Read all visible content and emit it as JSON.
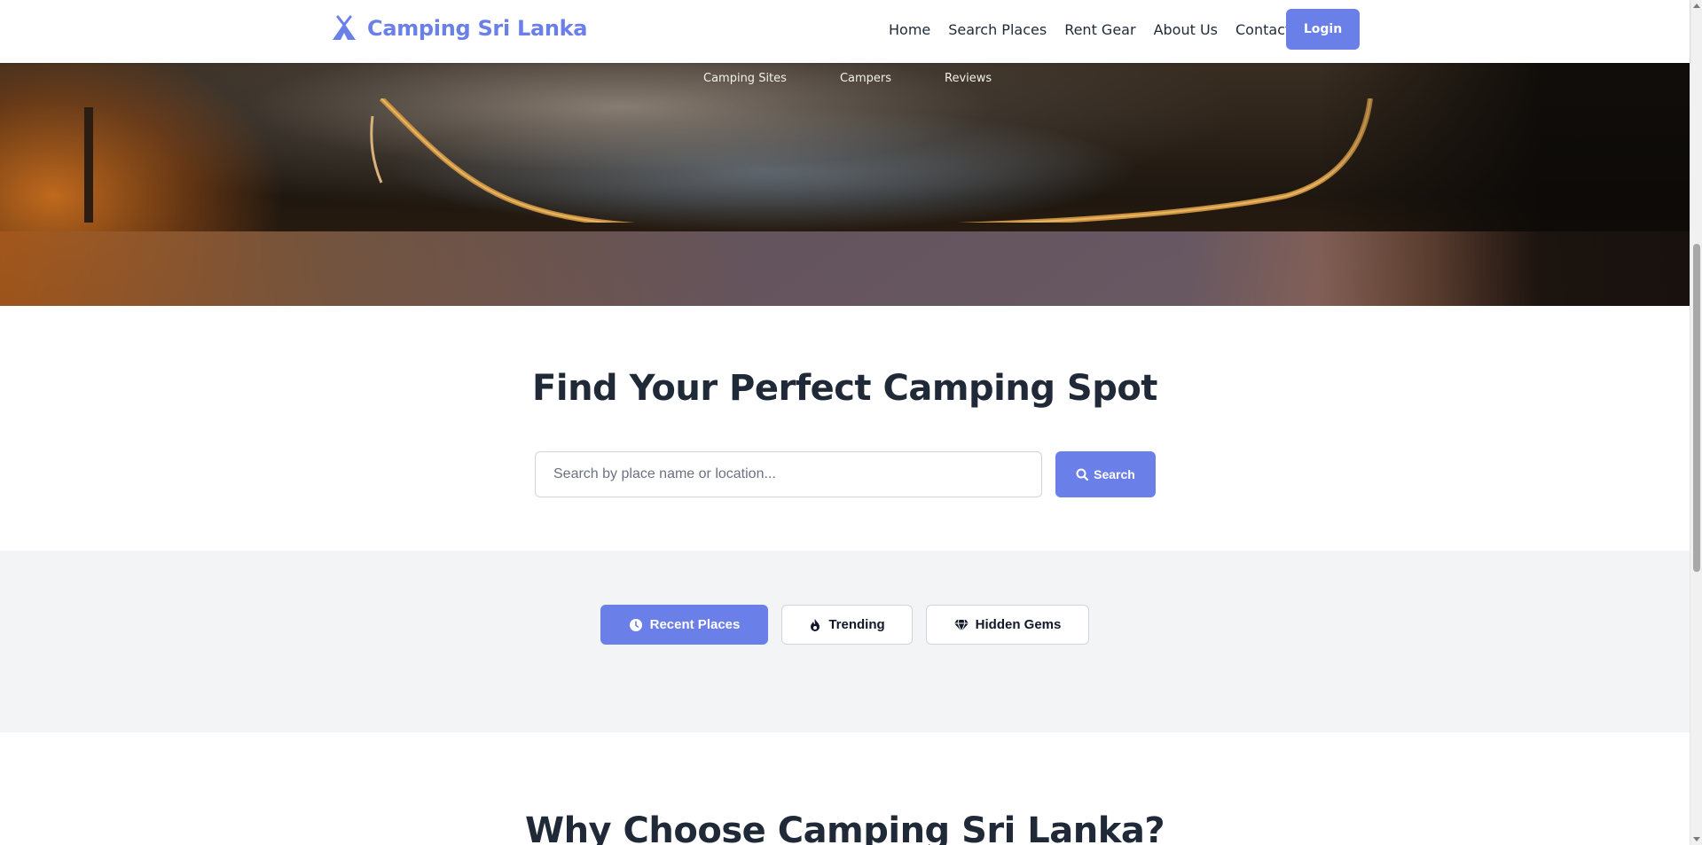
{
  "header": {
    "brand": "Camping Sri Lanka",
    "brand_icon": "campground-icon",
    "nav": [
      "Home",
      "Search Places",
      "Rent Gear",
      "About Us",
      "Contact"
    ],
    "login_label": "Login"
  },
  "hero": {
    "links": [
      "Camping Sites",
      "Campers",
      "Reviews"
    ]
  },
  "search": {
    "title": "Find Your Perfect Camping Spot",
    "placeholder": "Search by place name or location...",
    "button_label": "Search",
    "button_icon": "search-icon"
  },
  "filters": {
    "tabs": [
      {
        "label": "Recent Places",
        "icon": "clock-icon",
        "active": true
      },
      {
        "label": "Trending",
        "icon": "fire-icon",
        "active": false
      },
      {
        "label": "Hidden Gems",
        "icon": "gem-icon",
        "active": false
      }
    ]
  },
  "why": {
    "title": "Why Choose Camping Sri Lanka?"
  },
  "colors": {
    "accent": "#6b7fe8",
    "text": "#1f2937",
    "section_gray": "#f3f4f6"
  }
}
